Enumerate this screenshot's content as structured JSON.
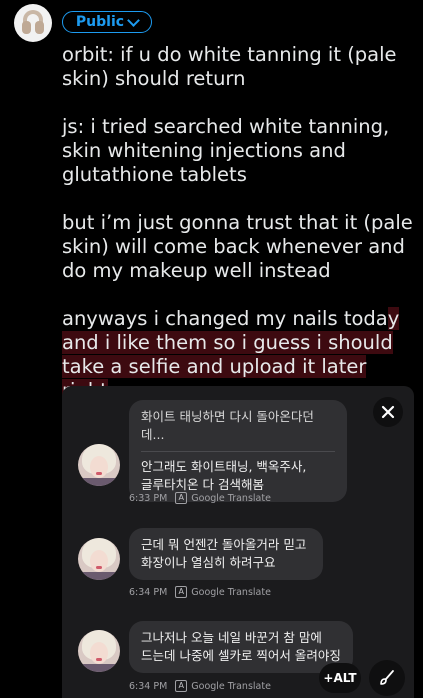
{
  "audience": {
    "label": "Public"
  },
  "post": {
    "paragraphs": [
      "orbit: if u do white tanning it (pale skin) should return",
      "js: i tried searched white tanning, skin whitening injections and glutathione tablets",
      "but i’m just gonna trust that it (pale skin) will come back whenever and do my makeup well instead"
    ],
    "last_paragraph": {
      "plain": "anyways i changed my nails toda",
      "highlighted": "y and i like them so i guess i should take a selfie and upload it later right"
    }
  },
  "chat": {
    "messages": [
      {
        "quote": "화이트 태닝하면 다시 돌아온다던데...",
        "text_line1": "안그래도 화이트태닝, 백옥주사,",
        "text_line2": "글루타치온 다 검색해봄",
        "time": "6:33 PM",
        "translate": "Google Translate"
      },
      {
        "text_line1": "근데 뭐 언젠간 돌아올거라 믿고",
        "text_line2": "화장이나 열심히 하려구요",
        "time": "6:34 PM",
        "translate": "Google Translate"
      },
      {
        "text_line1": "그나저나 오늘 네일 바꾼거 참 맘에",
        "text_line2": "드는데 나중에 셀카로 찍어서 올려야징",
        "time": "6:34 PM",
        "translate": "Google Translate"
      }
    ]
  },
  "controls": {
    "alt_label": "+ALT"
  },
  "icons": {
    "audience_chevron": "chevron-down-icon",
    "close": "close-icon",
    "edit": "brush-icon",
    "translate": "translate-icon"
  },
  "colors": {
    "accent": "#1d9bf0",
    "highlight": "#3d0a10",
    "media_bg": "#1b1b1d",
    "bubble": "#303033"
  }
}
